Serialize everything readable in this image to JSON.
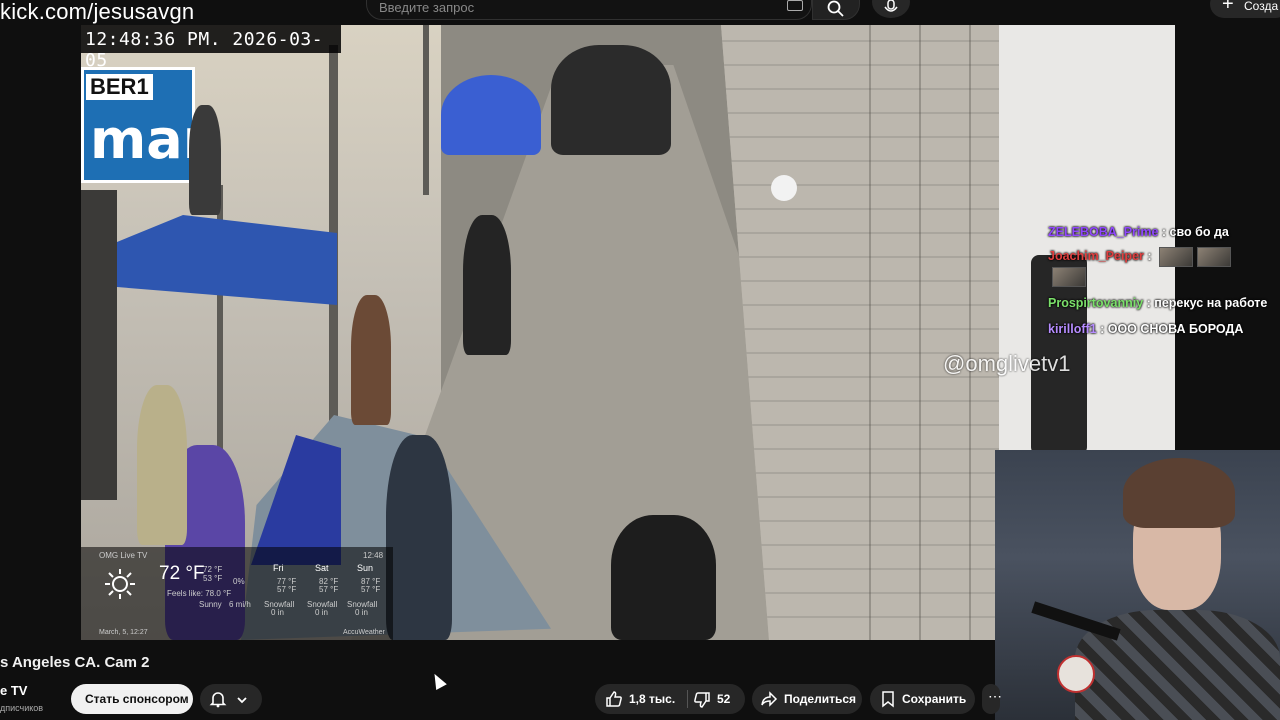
{
  "top": {
    "stream_url": "kick.com/jesusavgn",
    "search_placeholder": "Введите запрос",
    "create_label": "Созда",
    "icons": [
      "keyboard-icon",
      "search-icon",
      "mic-icon",
      "plus-icon"
    ]
  },
  "video": {
    "timestamp": "12:48:36 PM.   2026-03-05",
    "street_sign_top": "BER1",
    "street_sign_main": "man",
    "watermark": "@omglivetv1",
    "weather": {
      "brand": "OMG Live TV",
      "time": "12:48",
      "now_temp": "72 °F",
      "now_hi": "72 °F",
      "now_lo": "53 °F",
      "precip": "0%",
      "feels_like": "Feels like: 78.0 °F",
      "condition": "Sunny",
      "wind": "6 mi/h",
      "days": [
        {
          "name": "Fri",
          "hi": "77 °F",
          "lo": "57 °F",
          "snow": "Snowfall",
          "amount": "0 in"
        },
        {
          "name": "Sat",
          "hi": "82 °F",
          "lo": "57 °F",
          "snow": "Snowfall",
          "amount": "0 in"
        },
        {
          "name": "Sun",
          "hi": "87 °F",
          "lo": "57 °F",
          "snow": "Snowfall",
          "amount": "0 in"
        }
      ],
      "date": "March, 5, 12:27",
      "provider": "AccuWeather"
    }
  },
  "chat": [
    {
      "user": "ZELEBOBA_Prime",
      "text": " : сво бо да",
      "color": "#9147ff"
    },
    {
      "user": "Joachim_Peiper",
      "text": " :",
      "color": "#e04040"
    },
    {
      "user": "Prospirtovanniy",
      "text": " : перекус на работе",
      "color": "#7be06a"
    },
    {
      "user": "kirilloff1",
      "text": " : ООО СНОВА БОРОДА",
      "color": "#b68cff"
    }
  ],
  "below": {
    "title": "s Angeles CA. Cam 2",
    "channel": "e TV",
    "subs": "дписчиков",
    "sponsor": "Стать спонсором",
    "likes": "1,8 тыс.",
    "dislikes": "52",
    "share": "Поделиться",
    "save": "Сохранить",
    "icons": [
      "bell-icon",
      "chevron-down-icon",
      "thumbs-up-icon",
      "thumbs-down-icon",
      "share-icon",
      "bookmark-icon",
      "more-icon"
    ]
  }
}
